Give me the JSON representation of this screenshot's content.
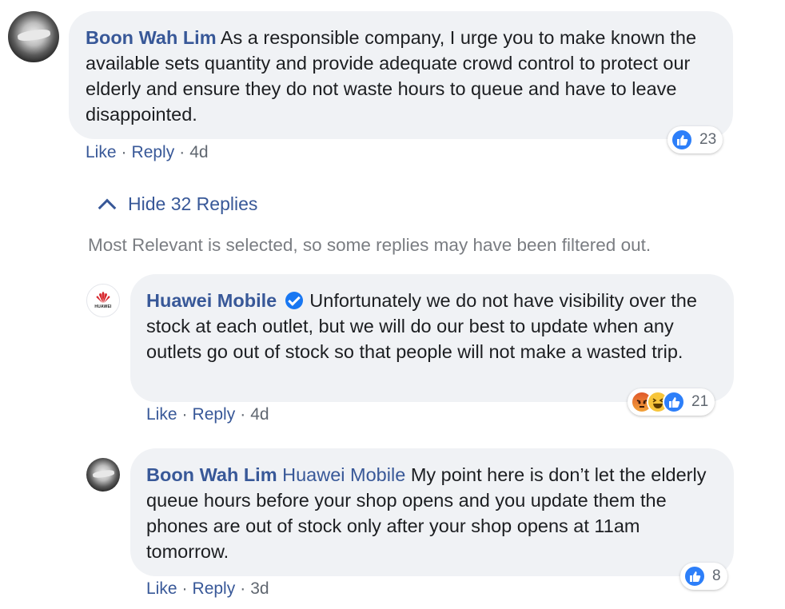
{
  "comments": [
    {
      "author": "Boon Wah Lim",
      "text": "As a responsible company, I urge you to make known the available sets quantity and provide adequate crowd control to protect our elderly and ensure they do not waste hours to queue and have to leave disappointed.",
      "actions": {
        "like": "Like",
        "reply": "Reply",
        "time": "4d"
      },
      "reaction_count": "23",
      "reaction_icons": [
        "like-icon"
      ]
    }
  ],
  "replies_toggle": {
    "label": "Hide 32 Replies",
    "icon": "chevron-up-icon"
  },
  "filter_note": "Most Relevant is selected, so some replies may have been filtered out.",
  "replies": [
    {
      "author": "Huawei Mobile",
      "verified": true,
      "avatar_text": "HUAWEI",
      "text": "Unfortunately we do not have visibility over the stock at each outlet, but we will do our best to update when any outlets go out of stock so that people will not make a wasted trip.",
      "actions": {
        "like": "Like",
        "reply": "Reply",
        "time": "4d"
      },
      "reaction_count": "21",
      "reaction_icons": [
        "angry-icon",
        "haha-icon",
        "like-icon"
      ]
    },
    {
      "author": "Boon Wah Lim",
      "mention": "Huawei Mobile",
      "text": "My point here is don’t let the elderly queue hours before your shop opens and you update them the phones are out of stock only after your shop opens at 11am tomorrow.",
      "actions": {
        "like": "Like",
        "reply": "Reply",
        "time": "3d"
      },
      "reaction_count": "8",
      "reaction_icons": [
        "like-icon"
      ]
    }
  ],
  "separator": "·"
}
